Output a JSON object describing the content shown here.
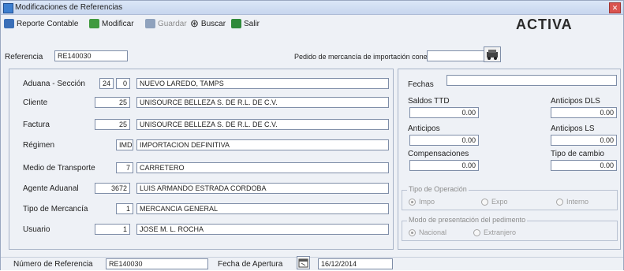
{
  "window": {
    "title": "Modificaciones de Referencias"
  },
  "toolbar": [
    {
      "label": "Reporte Contable",
      "icon": "report-icon",
      "color": "#3a6fb8",
      "enabled": true
    },
    {
      "label": "Modificar",
      "icon": "modify-icon",
      "color": "#3f9a3f",
      "enabled": true
    },
    {
      "label": "Guardar",
      "icon": "save-icon",
      "color": "#8fa2bd",
      "enabled": false
    },
    {
      "label": "Buscar",
      "icon": "binoculars-icon",
      "color": "#333333",
      "enabled": true
    },
    {
      "label": "Salir",
      "icon": "exit-icon",
      "color": "#2f8a3a",
      "enabled": true
    }
  ],
  "status": "ACTIVA",
  "referencia": {
    "label": "Referencia",
    "value": "RE140030"
  },
  "pedido": {
    "label": "Pedido de mercancía de importación conexa",
    "value": ""
  },
  "left_fields": [
    {
      "label": "Aduana - Sección",
      "code": "24",
      "code2": "0",
      "desc": "NUEVO LAREDO, TAMPS"
    },
    {
      "label": "Cliente",
      "code": "25",
      "desc": "UNISOURCE BELLEZA S. DE R.L. DE C.V."
    },
    {
      "label": "Factura",
      "code": "25",
      "desc": "UNISOURCE BELLEZA S. DE R.L. DE C.V."
    },
    {
      "label": "Régimen",
      "code": "IMD",
      "desc": "IMPORTACION DEFINITIVA"
    },
    {
      "label": "Medio de Transporte",
      "code": "7",
      "desc": "CARRETERO"
    },
    {
      "label": "Agente Aduanal",
      "code": "3672",
      "desc": "LUIS ARMANDO ESTRADA CORDOBA"
    },
    {
      "label": "Tipo de Mercancía",
      "code": "1",
      "desc": "MERCANCIA GENERAL"
    },
    {
      "label": "Usuario",
      "code": "1",
      "desc": "JOSE M. L. ROCHA"
    }
  ],
  "right_panel": {
    "fechas_label": "Fechas",
    "fechas_value": "",
    "left_col": [
      {
        "label": "Saldos TTD",
        "value": "0.00"
      },
      {
        "label": "Anticipos",
        "value": "0.00"
      },
      {
        "label": "Compensaciones",
        "value": "0.00"
      }
    ],
    "right_col": [
      {
        "label": "Anticipos DLS",
        "value": "0.00"
      },
      {
        "label": "Anticipos LS",
        "value": "0.00"
      },
      {
        "label": "Tipo de cambio",
        "value": "0.00"
      }
    ],
    "group1": {
      "legend": "Tipo de Operación",
      "options": [
        "Impo",
        "Expo",
        "Interno"
      ],
      "selected": 0
    },
    "group2": {
      "legend": "Modo de presentación del pedimento",
      "options": [
        "Nacional",
        "Extranjero"
      ],
      "selected": 0
    }
  },
  "bottom": {
    "numero_label": "Número de Referencia",
    "numero_value": "RE140030",
    "fecha_label": "Fecha de Apertura",
    "fecha_value": "16/12/2014"
  }
}
